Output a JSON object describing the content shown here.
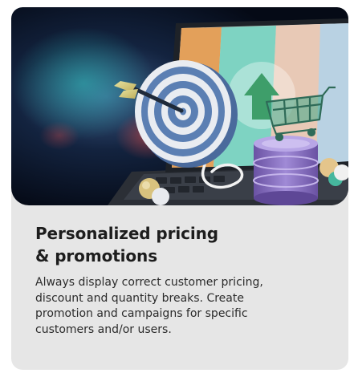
{
  "card": {
    "image_alt": "Dartboard with arrow in bullseye next to a shopping cart on a stack of coins in front of a laptop",
    "title_lines": [
      "Personalized pricing",
      "& promotions"
    ],
    "description_lines": [
      "Always display correct customer pricing,",
      "discount and quantity breaks. Create",
      "promotion and campaigns for specific",
      "customers and/or users."
    ]
  },
  "colors": {
    "card_background": "#e6e6e6",
    "title": "#1d1d1d",
    "body_text": "#2b2b2b",
    "hero_dark": "#0b1730",
    "dartboard_blue": "#5b7fb3",
    "coin_purple": "#8a6fc0",
    "cart_green": "#3ea889",
    "laptop_teal": "#7ed3c2",
    "laptop_orange": "#e3a05a"
  }
}
